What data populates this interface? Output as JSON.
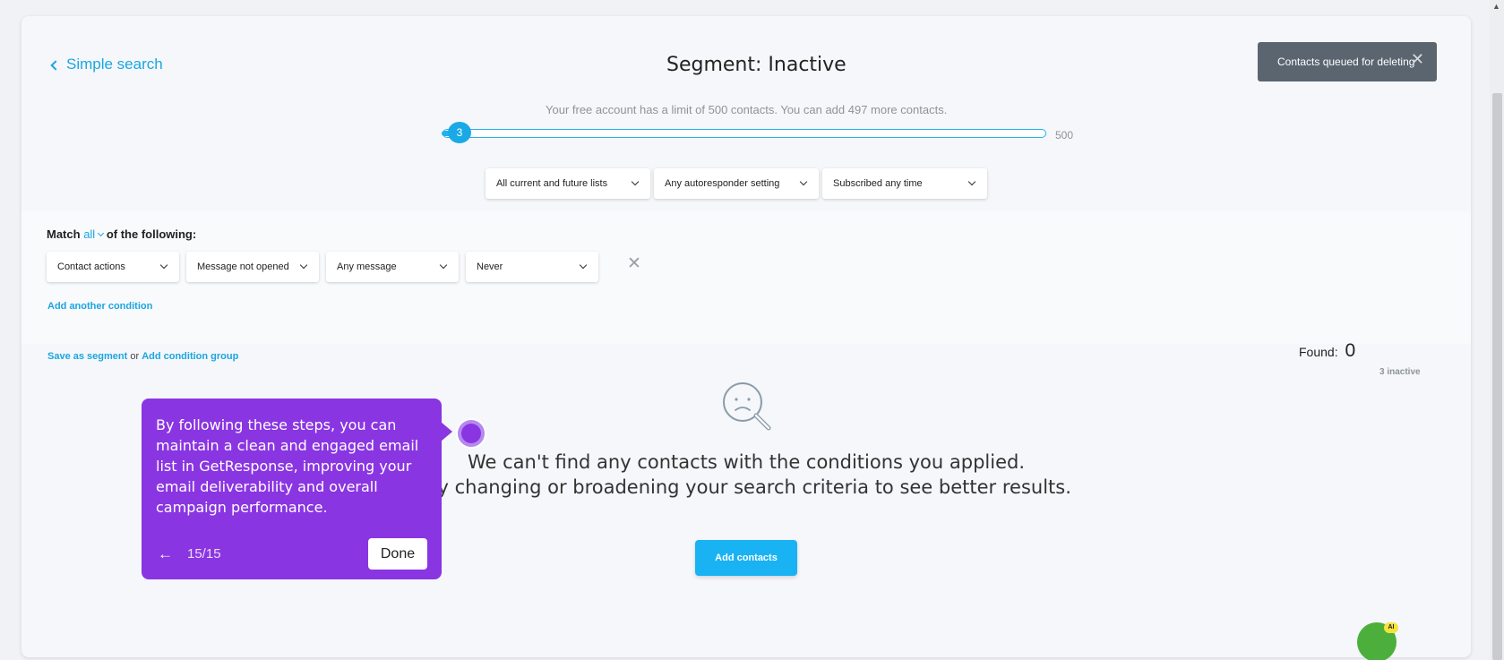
{
  "header": {
    "back_label": "Simple search",
    "title": "Segment: Inactive"
  },
  "toast": {
    "message": "Contacts queued for deleting"
  },
  "limit": {
    "text": "Your free account has a limit of 500 contacts. You can add 497 more contacts.",
    "current": "3",
    "max": "500"
  },
  "filters": [
    "All current and future lists",
    "Any autoresponder setting",
    "Subscribed any time"
  ],
  "match": {
    "prefix": "Match",
    "mode": "all",
    "suffix": "of the following:"
  },
  "conditions": [
    "Contact actions",
    "Message not opened",
    "Any message",
    "Never"
  ],
  "add_condition": "Add another condition",
  "actions": {
    "save_segment": "Save as segment",
    "or": "or",
    "add_group": "Add condition group"
  },
  "found": {
    "label": "Found:",
    "count": "0",
    "inactive": "3 inactive"
  },
  "empty": {
    "line1": "We can't find any contacts with the conditions you applied.",
    "line2": "Try changing or broadening your search criteria to see better results.",
    "button": "Add contacts"
  },
  "tooltip": {
    "message": "By following these steps, you can maintain a clean and engaged email list in GetResponse, improving your email deliverability and overall campaign performance.",
    "step": "15/15",
    "done": "Done"
  },
  "bot_badge": "AI"
}
